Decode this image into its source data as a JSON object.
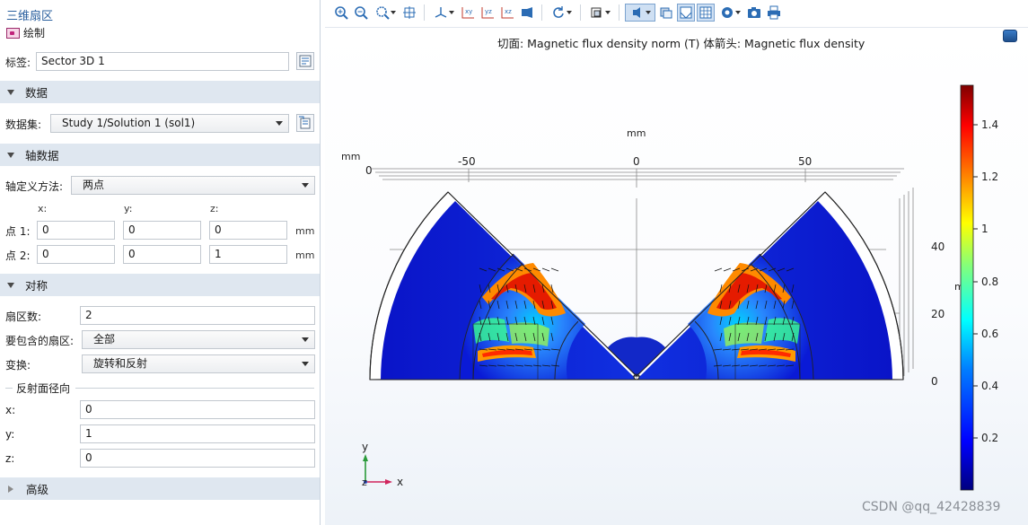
{
  "breadcrumb": "三维扇区",
  "plot_button": "绘制",
  "label_field": {
    "label": "标签:",
    "value": "Sector 3D 1"
  },
  "sections": {
    "data": "数据",
    "axis": "轴数据",
    "symmetry": "对称",
    "advanced": "高级"
  },
  "dataset": {
    "label": "数据集:",
    "value": "Study 1/Solution 1 (sol1)"
  },
  "axis_method": {
    "label": "轴定义方法:",
    "value": "两点"
  },
  "coord_headers": {
    "x": "x:",
    "y": "y:",
    "z": "z:"
  },
  "point1": {
    "label": "点 1:",
    "x": "0",
    "y": "0",
    "z": "0",
    "unit": "mm"
  },
  "point2": {
    "label": "点 2:",
    "x": "0",
    "y": "0",
    "z": "1",
    "unit": "mm"
  },
  "sectors": {
    "label": "扇区数:",
    "value": "2"
  },
  "include": {
    "label": "要包含的扇区:",
    "value": "全部"
  },
  "transform": {
    "label": "变换:",
    "value": "旋转和反射"
  },
  "reflection": {
    "header": "反射面径向",
    "x_label": "x:",
    "x_value": "0",
    "y_label": "y:",
    "y_value": "1",
    "z_label": "z:",
    "z_value": "0"
  },
  "graphics": {
    "title": "切面: Magnetic flux density norm (T)  体箭头: Magnetic flux density",
    "axis_unit_top": "mm",
    "axis_unit_left": "mm",
    "x_ticks": [
      "0",
      "-50",
      "0",
      "50"
    ],
    "y_ticks": [
      "40",
      "20",
      "0"
    ],
    "right_axis_cut": "m",
    "triad": {
      "x": "x",
      "y": "y",
      "z": "z"
    }
  },
  "colorbar": {
    "ticks": [
      "1.4",
      "1.2",
      "1",
      "0.8",
      "0.6",
      "0.4",
      "0.2"
    ],
    "colors": [
      "#00007f",
      "#0000ff",
      "#007fff",
      "#00ffff",
      "#7fff7f",
      "#ffff00",
      "#ff7f00",
      "#ff0000",
      "#7f0000"
    ]
  },
  "watermark": "CSDN @qq_42428839"
}
